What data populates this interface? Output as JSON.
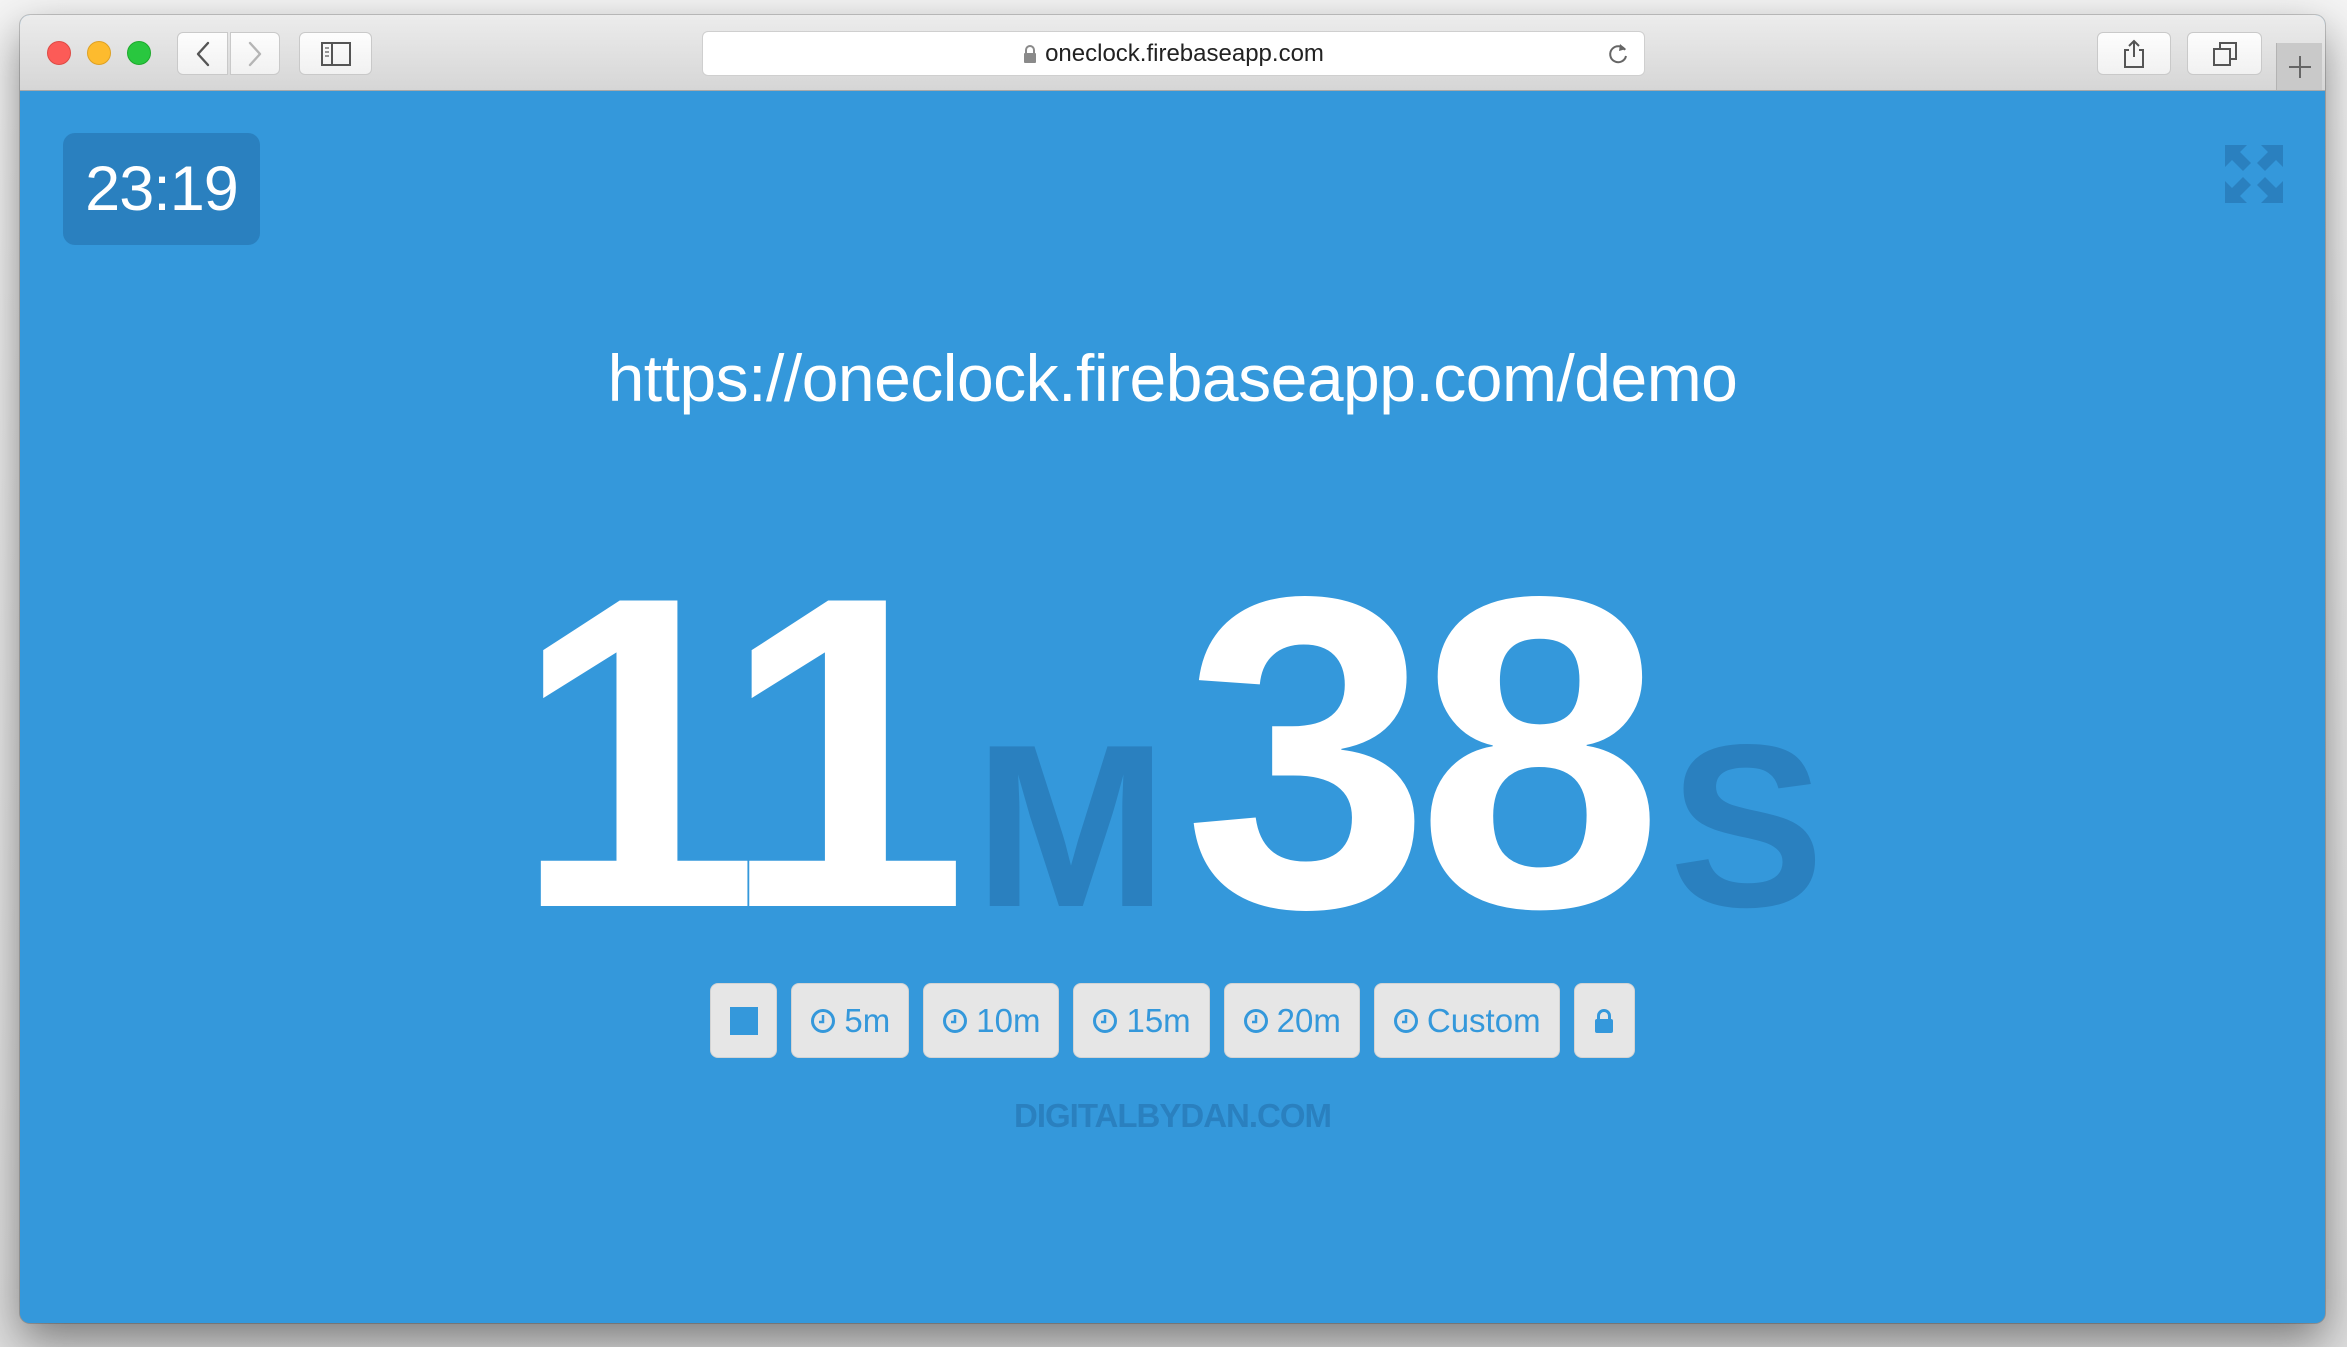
{
  "browser": {
    "address": "oneclock.firebaseapp.com",
    "icons": {
      "back": "chevron-left-icon",
      "forward": "chevron-right-icon",
      "sidebar": "sidebar-icon",
      "lock": "lock-icon",
      "reload": "reload-icon",
      "share": "share-icon",
      "tabs": "tabs-overview-icon",
      "new_tab": "plus-icon"
    }
  },
  "page": {
    "current_time": "23:19",
    "share_url": "https://oneclock.firebaseapp.com/demo",
    "countdown": {
      "minutes": "11",
      "minutes_unit": "M",
      "seconds": "38",
      "seconds_unit": "S"
    },
    "controls": [
      {
        "id": "stop",
        "label": "",
        "icon": "stop-icon"
      },
      {
        "id": "5m",
        "label": "5m",
        "icon": "clock-icon"
      },
      {
        "id": "10m",
        "label": "10m",
        "icon": "clock-icon"
      },
      {
        "id": "15m",
        "label": "15m",
        "icon": "clock-icon"
      },
      {
        "id": "20m",
        "label": "20m",
        "icon": "clock-icon"
      },
      {
        "id": "custom",
        "label": "Custom",
        "icon": "clock-icon"
      },
      {
        "id": "lock",
        "label": "",
        "icon": "lock-icon"
      }
    ],
    "credit": "DIGITALBYDAN.COM",
    "fullscreen_icon": "expand-icon"
  },
  "colors": {
    "background": "#3498db",
    "accent_dark": "#2a80bf",
    "button_bg": "#e6e6e6",
    "text_white": "#ffffff"
  }
}
